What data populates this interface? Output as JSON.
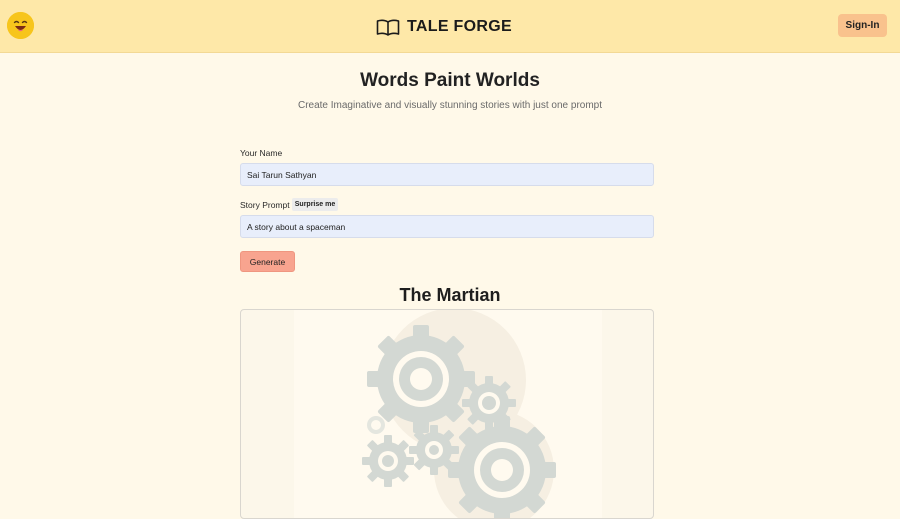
{
  "header": {
    "brand": "TALE FORGE",
    "signin_label": "Sign-In",
    "avatar_icon": "laughing-face-icon",
    "logo_icon": "open-book-icon",
    "background": "#fee8a8"
  },
  "hero": {
    "title": "Words Paint Worlds",
    "subtitle": "Create Imaginative and visually stunning stories with just one prompt"
  },
  "form": {
    "name_label": "Your Name",
    "name_value": "Sai Tarun Sathyan",
    "prompt_label": "Story Prompt",
    "surprise_label": "Surprise me",
    "prompt_value": "A story about a spaceman",
    "generate_label": "Generate"
  },
  "story": {
    "title": "The Martian",
    "image_icon": "gears-loading-icon"
  },
  "colors": {
    "page_bg": "#fff9e9",
    "input_bg": "#e8eefb",
    "generate_bg": "#f8a48f",
    "signin_bg": "#f9c28d"
  }
}
